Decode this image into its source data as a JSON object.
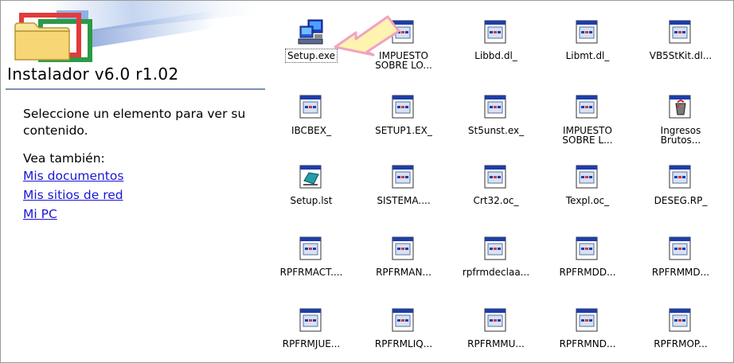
{
  "panel": {
    "title": "Instalador v6.0 r1.02",
    "description": "Seleccione un elemento para ver su contenido.",
    "see_also_label": "Vea también:",
    "links": [
      "Mis documentos",
      "Mis sitios de red",
      "Mi PC"
    ]
  },
  "files": [
    {
      "label": "Setup.exe",
      "icon": "setup-computer-icon",
      "selected": true
    },
    {
      "label": "IMPUESTO\nSOBRE LO...",
      "icon": "file-icon"
    },
    {
      "label": "Libbd.dl_",
      "icon": "file-icon"
    },
    {
      "label": "Libmt.dl_",
      "icon": "file-icon"
    },
    {
      "label": "VB5StKit.dl...",
      "icon": "file-icon"
    },
    {
      "label": "IBCBEX_",
      "icon": "file-icon"
    },
    {
      "label": "SETUP1.EX_",
      "icon": "file-icon"
    },
    {
      "label": "St5unst.ex_",
      "icon": "file-icon"
    },
    {
      "label": "IMPUESTO\nSOBRE L...",
      "icon": "file-icon"
    },
    {
      "label": "Ingresos\nBrutos...",
      "icon": "recycle-file-icon"
    },
    {
      "label": "Setup.lst",
      "icon": "setup-list-icon"
    },
    {
      "label": "SISTEMA....",
      "icon": "file-icon"
    },
    {
      "label": "Crt32.oc_",
      "icon": "file-icon"
    },
    {
      "label": "Texpl.oc_",
      "icon": "file-icon"
    },
    {
      "label": "DESEG.RP_",
      "icon": "file-icon"
    },
    {
      "label": "RPFRMACT....",
      "icon": "file-icon"
    },
    {
      "label": "RPFRMAN...",
      "icon": "file-icon"
    },
    {
      "label": "rpfrmdeclaa...",
      "icon": "file-icon"
    },
    {
      "label": "RPFRMDD...",
      "icon": "file-icon"
    },
    {
      "label": "RPFRMMD...",
      "icon": "file-icon"
    },
    {
      "label": "RPFRMJUE...",
      "icon": "file-icon"
    },
    {
      "label": "RPFRMLIQ...",
      "icon": "file-icon"
    },
    {
      "label": "RPFRMMU...",
      "icon": "file-icon"
    },
    {
      "label": "RPFRMND...",
      "icon": "file-icon"
    },
    {
      "label": "RPFRMOP...",
      "icon": "file-icon"
    }
  ],
  "colors": {
    "link": "#1a16d4",
    "rule": "#7b8fb8",
    "arrow": "#fff3b0"
  }
}
